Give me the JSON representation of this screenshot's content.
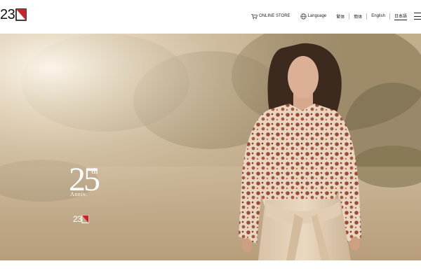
{
  "brand": {
    "logo_text": "23"
  },
  "nav": {
    "online_store": "ONLINE STORE",
    "language": "Language",
    "trad_chinese": "繁体",
    "simp_chinese": "簡体",
    "english": "English",
    "japanese": "日本語"
  },
  "hero": {
    "anniversary_number": "25",
    "anniversary_suffix": "th",
    "anniversary_label": "Anniv.",
    "logo_text": "23"
  },
  "colors": {
    "brand_red": "#d0212b",
    "text": "#222222"
  }
}
